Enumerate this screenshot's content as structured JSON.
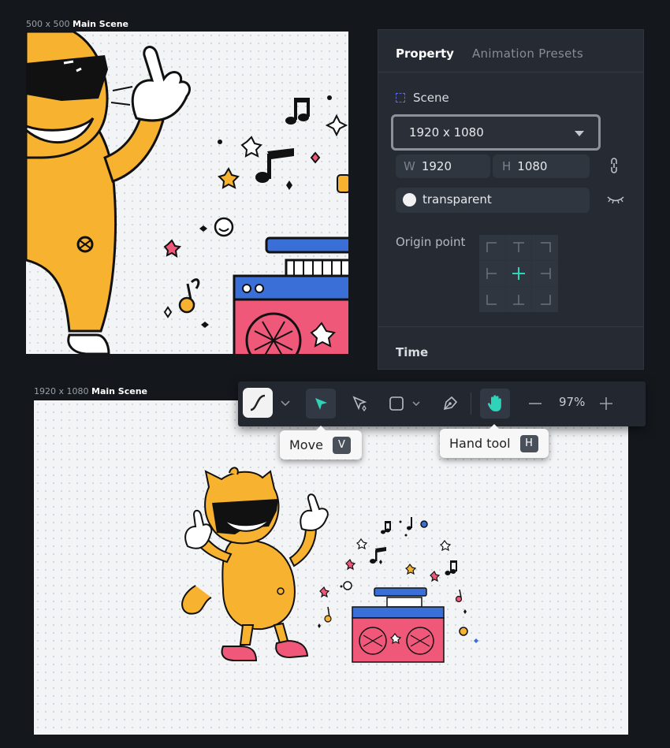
{
  "top_scene": {
    "size_label": "500 x 500",
    "name": "Main Scene"
  },
  "bottom_scene": {
    "size_label": "1920 x 1080",
    "name": "Main Scene"
  },
  "panel": {
    "tabs": [
      "Property",
      "Animation Presets"
    ],
    "scene_section": "Scene",
    "preset_value": "1920 x 1080",
    "width_prefix": "W",
    "width_value": "1920",
    "height_prefix": "H",
    "height_value": "1080",
    "background_value": "transparent",
    "origin_label": "Origin point",
    "time_section": "Time"
  },
  "toolbar": {
    "zoom": "97%"
  },
  "tooltips": {
    "move": {
      "label": "Move",
      "key": "V"
    },
    "hand": {
      "label": "Hand tool",
      "key": "H"
    }
  },
  "colors": {
    "accent": "#2fd3b9",
    "cat": "#f7b230",
    "boombox": "#f0587a",
    "boombox_top": "#3b6fd8"
  }
}
